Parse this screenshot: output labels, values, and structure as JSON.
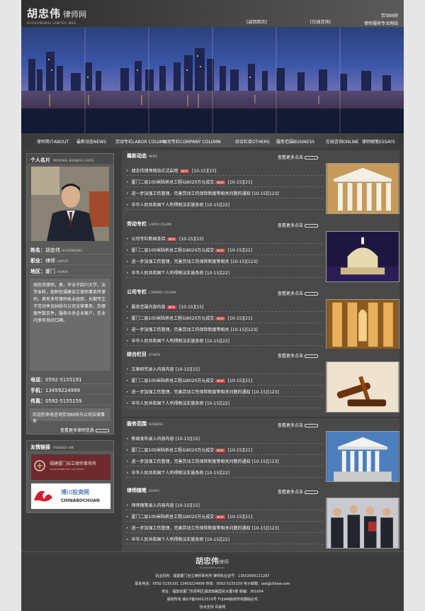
{
  "header": {
    "logo_cn": "胡忠伟",
    "logo_cn2": "律师网",
    "logo_en": "HUZHONGWEI LAWYER WEB",
    "link1": "[返回首页]",
    "link2": "[在线咨询]",
    "right1": "劳动纠纷",
    "right2": "律师服务专业网站"
  },
  "menu": [
    "律师简介ABOUT",
    "最新动态NEWS",
    "劳动专栏LABOR COLUMN",
    "公司专栏COMPANY COLUMN",
    "综合栏目OTHERS",
    "服务范围BUSINESS",
    "在线咨询ONLINE",
    "律师随笔ESSAYS"
  ],
  "profile": {
    "title": "个人名片",
    "title_en": "PERSONAL BUSINESS CARDS",
    "name_label": "姓名：",
    "name": "胡忠伟",
    "name_en": "HUZHONGWEI",
    "job_label": "职业：",
    "job": "律师",
    "job_en": "LAWYER",
    "area_label": "地区：",
    "area": "厦门",
    "area_en": "XIAMEN",
    "bio": "胡忠伟律师，男，毕业于四川大学，法学本科，现担任福建自立律师事务所律师，具有多年律师执业经验，长期专注于劳动争议纠纷与公司法律事务，办理案件数百件，服务众多企业客户，在业内享有良好口碑。",
    "tel_label": "电话：",
    "tel": "0592-5155191",
    "mobile_label": "手机：",
    "mobile": "13459224999",
    "fax_label": "传真：",
    "fax": "0592-5155159",
    "scope": "欢迎您来电咨询劳动纠纷与公司法律事务",
    "more": "查看更多律师信息"
  },
  "friend_links": {
    "title": "友情链接",
    "title_en": "FRIENDLY LINK",
    "logo1_cn": "福建厦门自立律师事务所",
    "logo1_en": "FUJIAN XIAMEN ZILI LAW OFFICE",
    "logo2_cn": "博川投资网",
    "logo2_en": "CHINABOCHUAN"
  },
  "sections": [
    {
      "title": "最新动态",
      "title_en": "NEWS",
      "more": "查看更多点击",
      "items": [
        {
          "text": "胡忠伟律师网站正式启用",
          "new": true,
          "meta": "[10-15][15]"
        },
        {
          "text": "厦门二层100米陆桥总工程以8020万元成交",
          "new": true,
          "meta": "[10-15][21]"
        },
        {
          "text": "进一步加强工伤管理，完善劳动工伤保险制度等相关问题的通知",
          "new": false,
          "meta": "[10-15][123]"
        },
        {
          "text": "中华人民共和国个人所得税法实施条例",
          "new": false,
          "meta": "[10-15][22]"
        }
      ]
    },
    {
      "title": "劳动专栏",
      "title_en": "LABOR COLUMN",
      "more": "查看更多点击",
      "items": [
        {
          "text": "公司专栏新闻条目",
          "new": true,
          "meta": "[10-15][15]"
        },
        {
          "text": "厦门二层100米陆桥总工程以8020万元成交",
          "new": true,
          "meta": "[10-15][21]"
        },
        {
          "text": "进一步加强工伤管理，完善劳动工伤保险制度等相关",
          "new": false,
          "meta": "[10-15][123]"
        },
        {
          "text": "中华人民共和国个人所得税法实施条例",
          "new": false,
          "meta": "[10-15][22]"
        }
      ]
    },
    {
      "title": "公司专栏",
      "title_en": "COMPANY COLUMN",
      "more": "查看更多点击",
      "items": [
        {
          "text": "服务范围内容内容",
          "new": true,
          "meta": "[10-15][15]"
        },
        {
          "text": "厦门二层100米陆桥总工程以8020万元成交",
          "new": true,
          "meta": "[10-15][21]"
        },
        {
          "text": "进一步加强工伤管理，完善劳动工伤保险制度等相关",
          "new": false,
          "meta": "[10-15][123]"
        },
        {
          "text": "中华人民共和国个人所得税法实施条例",
          "new": false,
          "meta": "[10-15][22]"
        }
      ]
    },
    {
      "title": "综合栏目",
      "title_en": "OTHERS",
      "more": "查看更多点击",
      "items": [
        {
          "text": "文章研究录入内容内容",
          "new": false,
          "meta": "[10-15][15]"
        },
        {
          "text": "厦门二层100米陆桥总工程以8020万元成交",
          "new": true,
          "meta": "[10-15][21]"
        },
        {
          "text": "进一步加强工伤管理，完善劳动工伤保险制度等相关问题的通知",
          "new": false,
          "meta": "[10-15][123]"
        },
        {
          "text": "中华人民共和国个人所得税法实施条例",
          "new": false,
          "meta": "[10-15][22]"
        }
      ]
    },
    {
      "title": "服务范围",
      "title_en": "BUSINESS",
      "more": "查看更多点击",
      "items": [
        {
          "text": "新闻发布录入内容内容",
          "new": false,
          "meta": "[10-15][15]"
        },
        {
          "text": "厦门二层100米陆桥总工程以8020万元成交",
          "new": true,
          "meta": "[10-15][21]"
        },
        {
          "text": "进一步加强工伤管理，完善劳动工伤保险制度等相关问题的通知",
          "new": false,
          "meta": "[10-15][123]"
        },
        {
          "text": "中华人民共和国个人所得税法实施条例",
          "new": false,
          "meta": "[10-15][22]"
        }
      ]
    },
    {
      "title": "律师随笔",
      "title_en": "ESSAYS",
      "more": "查看更多点击",
      "items": [
        {
          "text": "律师随笔录入内容内容",
          "new": false,
          "meta": "[10-15][15]"
        },
        {
          "text": "厦门二层100米陆桥总工程以8020万元成交",
          "new": true,
          "meta": "[10-15][21]"
        },
        {
          "text": "进一步加强工伤管理，完善劳动工伤保险制度等相关问题的通知",
          "new": false,
          "meta": "[10-15][123]"
        },
        {
          "text": "中华人民共和国个人所得税法实施条例",
          "new": false,
          "meta": "[10-15][22]"
        }
      ]
    }
  ],
  "footer": {
    "logo_cn": "胡忠伟",
    "logo_cn2": "律师",
    "logo_en": "HUZHONGWEI LAWYER",
    "line1": "执业机构：福建厦门自立律师事务所 律师执业证号：13502006111287",
    "line2": "联系电话：0592-5155191 13459224999 传真：0592-5155159 电子邮箱：law@zililaw.com",
    "line3": "地址：福建省厦门市思明区湖滨南路国贸大厦5楼 邮编：361004",
    "line4": "版权所有 闽ICP备06012510号 FUJIAN版权所有翻版必究",
    "line5": "技术支持 百家网"
  }
}
